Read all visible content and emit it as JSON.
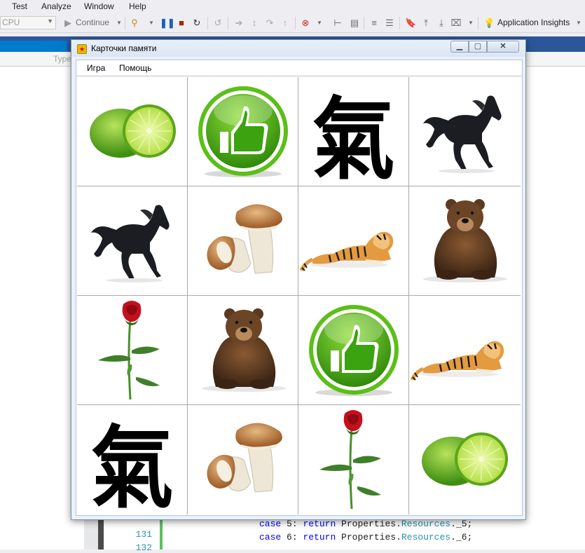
{
  "ide": {
    "menu": [
      "Test",
      "Analyze",
      "Window",
      "Help"
    ],
    "toolbar": {
      "platform": "CPU",
      "continue_label": "Continue",
      "app_insights_label": "Application Insights"
    },
    "navbar_type_label": "Type",
    "code": [
      {
        "line": "131",
        "keyword": "case",
        "rest": " 5: ",
        "kw2": "return",
        "mid": " Properties.",
        "cls": "Resources",
        "tail": "._5;"
      },
      {
        "line": "132",
        "keyword": "case",
        "rest": " 6: ",
        "kw2": "return",
        "mid": " Properties.",
        "cls": "Resources",
        "tail": "._6;"
      }
    ]
  },
  "window": {
    "title": "Карточки памяти",
    "menu": [
      "Игра",
      "Помощь"
    ],
    "cards": [
      {
        "image": "lime"
      },
      {
        "image": "thumbs-up"
      },
      {
        "image": "kanji",
        "text": "氣"
      },
      {
        "image": "horse"
      },
      {
        "image": "horse"
      },
      {
        "image": "mushroom"
      },
      {
        "image": "tiger"
      },
      {
        "image": "bear"
      },
      {
        "image": "rose"
      },
      {
        "image": "bear"
      },
      {
        "image": "thumbs-up"
      },
      {
        "image": "tiger"
      },
      {
        "image": "kanji",
        "text": "氣"
      },
      {
        "image": "mushroom"
      },
      {
        "image": "rose"
      },
      {
        "image": "lime"
      }
    ]
  }
}
